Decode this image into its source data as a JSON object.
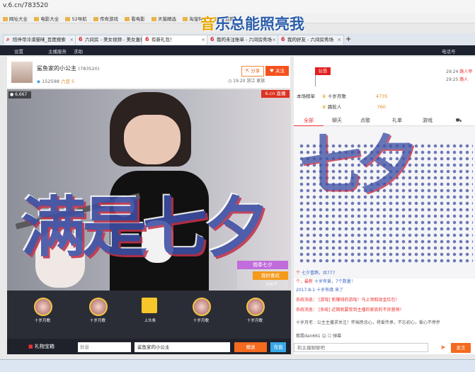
{
  "browser": {
    "url": "v.6.cn/783520",
    "bookmarks": [
      "网址大全",
      "电影大全",
      "52导航",
      "传奇游戏",
      "看电影",
      "天猫精选",
      "淘宝特卖",
      "聚划算"
    ],
    "tabs": [
      {
        "label": "陪伴帝冷漠猫咪_百度搜索"
      },
      {
        "label": "六间房 - 美女视频 - 美女直播"
      },
      {
        "label": "有新礼包！"
      },
      {
        "label": "我的未注账单 - 六间房秀场"
      },
      {
        "label": "我的好友 - 六间房秀场"
      }
    ]
  },
  "overlay_title": {
    "first_char": "音",
    "rest": "乐总能照亮我"
  },
  "site_header": {
    "settings": "设置",
    "items": [
      "主播服务",
      "求助"
    ],
    "right": "电话号"
  },
  "anchor": {
    "name": "鲨鱼家的小公主",
    "room_id": "(783520)",
    "fans": "152598",
    "level": "六豆 5",
    "time": "19:20",
    "location": "浙江",
    "family": "家族",
    "share_label": "分享",
    "follow_label": "关注"
  },
  "flag_label": "公告",
  "top_chat": [
    {
      "time": "29:24",
      "user": "路人甲"
    },
    {
      "time": "29:25",
      "user": "路人"
    }
  ],
  "rank": [
    {
      "label": "十岁月歌",
      "amount": "4735"
    },
    {
      "label": "路轮人",
      "amount": "760"
    }
  ],
  "rank_title": "本场榜单",
  "chat_tabs": [
    "全部",
    "聊天",
    "点歌",
    "礼单",
    "游戏"
  ],
  "video": {
    "viewers": "6,667",
    "logo": "6.cn 直播",
    "effect_text": "满是七夕",
    "gift_name": "情牵七夕",
    "gift_msg": "我好喜欢",
    "gift_count": "100个"
  },
  "flood_text": "七夕",
  "chat_messages": [
    {
      "sys": "个",
      "user": "七夕喜鹊，共777"
    },
    {
      "sys": "个，最新",
      "user": "十岁有爱，7个数量！"
    },
    {
      "sys": "",
      "user": "2017-8-1 十岁有缘 来了"
    },
    {
      "sys": "系统消息：",
      "user": "[游戏] 新赚钱的游戏！马上领取现金红包！"
    },
    {
      "sys": "系统消息：",
      "user": "[系统] 近期就要受到主播的家族的不良营销！"
    },
    {
      "sys": "",
      "user": "十岁月老 : 公主主播求关注！怀揣思念心，将爱传承，不忘初心，爱心不停步"
    }
  ],
  "bullet_label": "弹幕",
  "chat_user_label": "紫霞dan661",
  "chat_input_placeholder": "和主播聊聊吧",
  "send_label": "发言",
  "gifts": [
    {
      "label": "十岁月歌"
    },
    {
      "label": "十岁月歌"
    },
    {
      "label": "上头条"
    },
    {
      "label": "十岁月歌"
    },
    {
      "label": "十岁月歌"
    }
  ],
  "bottom_bar": {
    "gift_chest": "礼物宝箱",
    "qty_placeholder": "数量",
    "recipient": "鲨鱼家的小公主",
    "give_label": "赠送",
    "charge_label": "充值"
  }
}
